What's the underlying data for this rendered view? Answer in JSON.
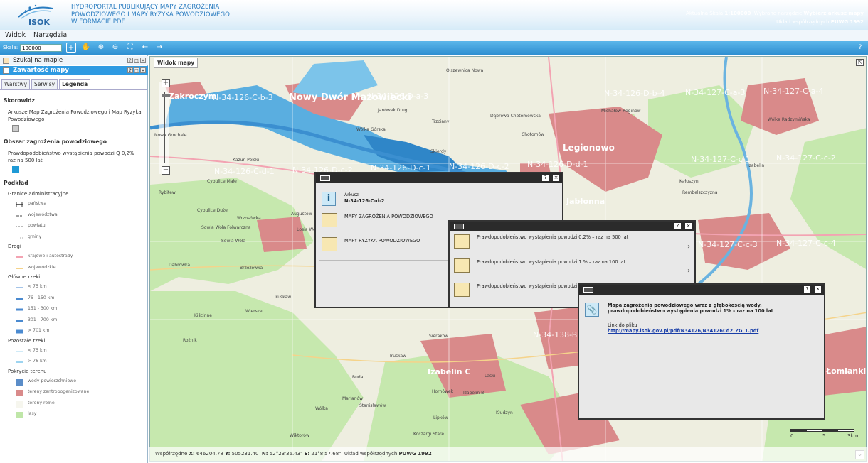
{
  "header": {
    "logo_text": "ISOK",
    "title_lines": [
      "HYDROPORTAL PUBLIKUJĄCY MAPY ZAGROŻENIA",
      "POWODZIOWEGO I MAPY RYZYKA POWODZIOWEGO",
      "W FORMACIE PDF"
    ],
    "scale_label": "Aktualna Skala",
    "scale_value": "1:100000",
    "tool_label": "Wybrane narzędzie",
    "tool_value": "Wybierz arkusz mapy",
    "crs_label": "Układ współrzędnych",
    "crs_value": "PUWG 1992"
  },
  "menu": {
    "items": [
      "Widok",
      "Narzędzia"
    ]
  },
  "toolbar": {
    "scale_label": "Skala:",
    "scale_value": "100000"
  },
  "sidebar": {
    "search_panel": "Szukaj na mapie",
    "content_panel": "Zawartość mapy",
    "tabs": [
      "Warstwy",
      "Serwisy",
      "Legenda"
    ],
    "legend": {
      "skorowidz": "Skorowidz",
      "skorowidz_item": "Arkusze Map Zagrożenia Powodziowego i Map Ryzyka Powodziowego",
      "obszar": "Obszar zagrożenia powodziowego",
      "obszar_item": "Prawdopodobieństwo wystąpienia powodzi Q 0,2% raz na 500 lat",
      "podklad": "Podkład",
      "granice": "Granice administracyjne",
      "granice_items": [
        "państwa",
        "województwa",
        "powiatu",
        "gminy"
      ],
      "drogi": "Drogi",
      "drogi_items": [
        "krajowe i autostrady",
        "wojewódzkie"
      ],
      "rzeki": "Główne rzeki",
      "rzeki_items": [
        "< 75 km",
        "76 - 150 km",
        "151 - 300 km",
        "301 - 700 km",
        "> 701 km"
      ],
      "pozostale": "Pozostałe rzeki",
      "pozostale_items": [
        "< 75 km",
        "> 76 km"
      ],
      "pokrycie": "Pokrycie terenu",
      "pokrycie_items": [
        "wody powierzchniowe",
        "tereny zantropogenizowane",
        "tereny rolne",
        "lasy"
      ]
    }
  },
  "map": {
    "tab": "Widok mapy",
    "sheets": [
      "N-34-126-C-b-3",
      "N-34-126-D-a-3",
      "N-34-126-D-b-4",
      "N-34-127-C-a-3",
      "N-34-127-C-a-4",
      "N-34-126-C-d-1",
      "N-34-126-D-c-2",
      "N-34-126-D-c-1",
      "N-34-126-D-c-2",
      "N-34-126-D-d-1",
      "N-34-127-C-c-1",
      "N-34-127-C-c-2",
      "N-34-127-C-c-3",
      "N-34-127-C-c-4",
      "N-34-138-B"
    ],
    "towns": [
      "Nowy Dwór Mazowiecki",
      "Zakroczym",
      "Legionowo",
      "Jabłonna",
      "Izabelin C",
      "Łomianki"
    ],
    "places": [
      "Olszewnica Nowa",
      "Janówek Drugi",
      "Wólka Górska",
      "Dąbrowa Chotomowska",
      "Chotomów",
      "Michałów-Reginów",
      "Wólka Radzymińska",
      "Nowa Grochale",
      "Kazuń Polski",
      "Cybulice Małe",
      "Rybitew",
      "Cybulice Duże",
      "Augustów",
      "Wrzosówka",
      "Sowia Wola Folwarczna",
      "Łosia Wola",
      "Sowia Wola",
      "Dąbrowka",
      "Brzozówka",
      "Truskaw",
      "Kiścinne",
      "Wiersze",
      "Rożnik",
      "Buda",
      "Hornówek",
      "Izabelin B",
      "Laski",
      "Kłudzyn",
      "Lipków",
      "Marianów",
      "Wólka",
      "Stanisławów",
      "Koczargi Stare",
      "Wiktorów",
      "Truskaw",
      "Sieraków",
      "Skierdy",
      "Trzciany",
      "Kałuszyn",
      "Rembelszczyzna",
      "Izabelin"
    ],
    "scale_bar": [
      "0",
      "5",
      "3km"
    ]
  },
  "dialog1": {
    "arkusz_label": "Arkusz",
    "arkusz_value": "N-34-126-C-d-2",
    "item1": "MAPY ZAGROŻENIA POWODZIOWEGO",
    "item2": "MAPY RYZYKA POWODZIOWEGO"
  },
  "dialog2": {
    "items": [
      "Prawdopodobieństwo wystąpienia powodzi 0,2% – raz na 500 lat",
      "Prawdopodobieństwo wystąpienia powodzi 1 % – raz na 100 lat",
      "Prawdopodobieństwo wystąpienia powodzi"
    ]
  },
  "dialog3": {
    "title_line1": "Mapa zagrożenia powodziowego wraz z głębokością wody,",
    "title_line2": "prawdopodobieństwo wystąpienia powodzi 1% – raz na 100 lat",
    "link_label": "Link do pliku",
    "link_url": "http://mapy.isok.gov.pl/pdf/N34126/N34126Cd2_ZG_1.pdf"
  },
  "status": {
    "coords_label": "Współrzędne",
    "x_label": "X:",
    "x": "646204.78",
    "y_label": "Y:",
    "y": "505231.40",
    "n_label": "N:",
    "n": "52°23'36.43\"",
    "e_label": "E:",
    "e": "21°8'57.68\"",
    "crs_label": "Układ współrzędnych",
    "crs": "PUWG 1992"
  }
}
